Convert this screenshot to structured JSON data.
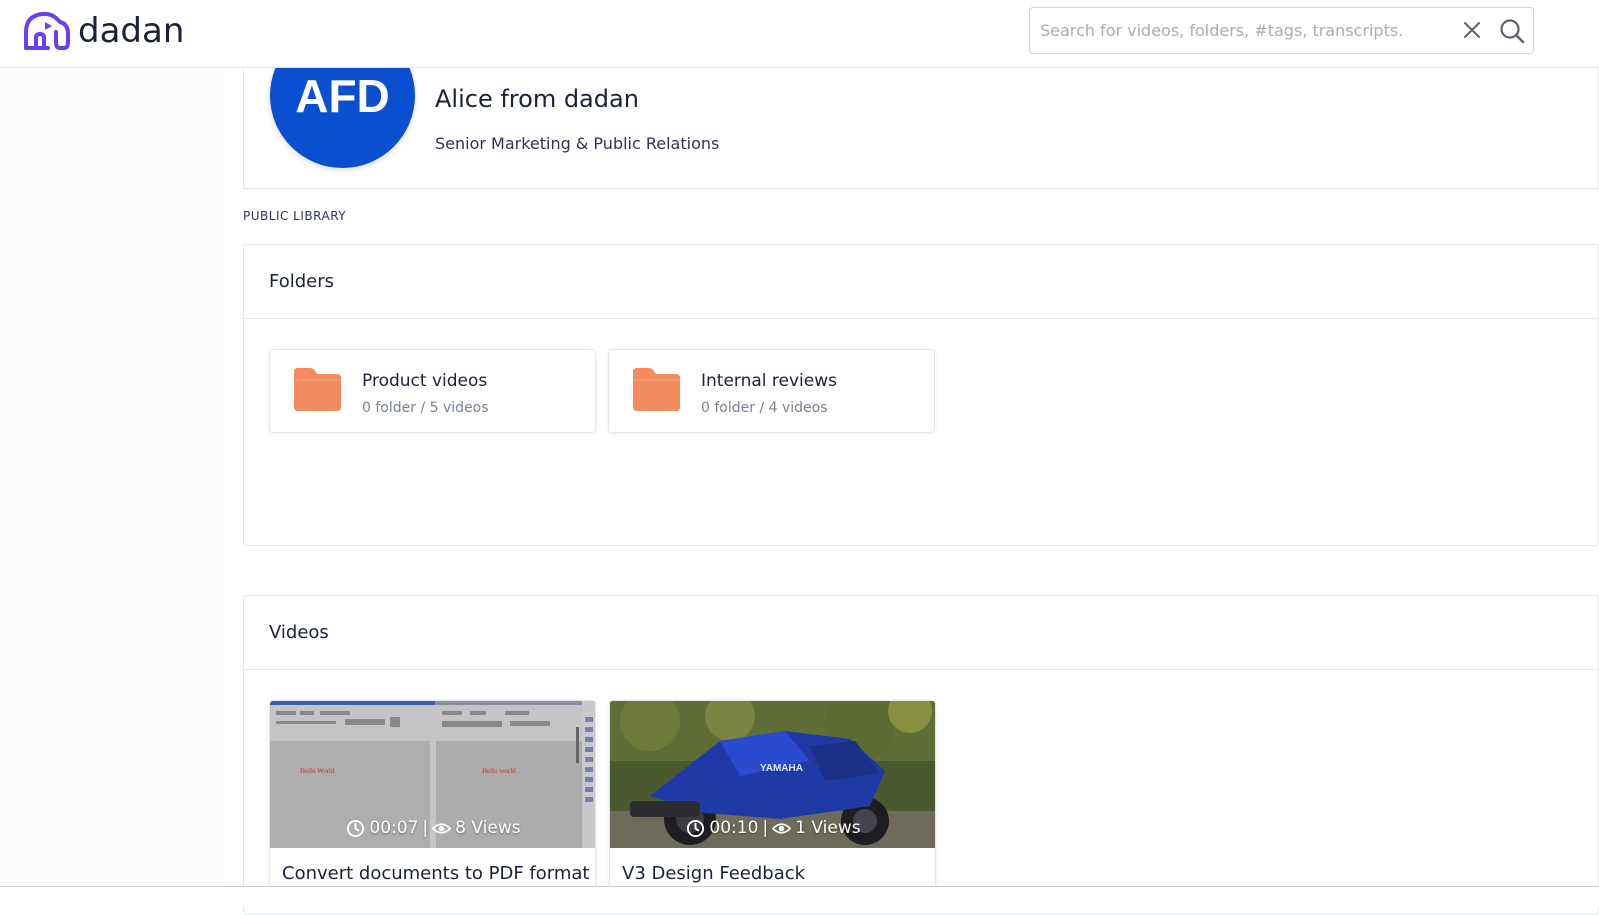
{
  "app": {
    "name": "dadan",
    "brand_color": "#6a3df0"
  },
  "search": {
    "placeholder": "Search for videos, folders, #tags, transcripts.",
    "value": ""
  },
  "profile": {
    "initials": "AFD",
    "name": "Alice from dadan",
    "role": "Senior Marketing & Public Relations",
    "avatar_color": "#0a4fcf"
  },
  "library": {
    "label": "PUBLIC LIBRARY",
    "folders_title": "Folders",
    "folders": [
      {
        "name": "Product videos",
        "meta": "0 folder / 5 videos",
        "icon": "folder-icon",
        "color": "#f28b5e"
      },
      {
        "name": "Internal reviews",
        "meta": "0 folder / 4 videos",
        "icon": "folder-icon",
        "color": "#f28b5e"
      }
    ],
    "videos_title": "Videos",
    "videos": [
      {
        "title": "Convert documents to PDF format",
        "duration": "00:07",
        "separator": "|",
        "views": "8 Views",
        "thumb_text_left": "Hello World",
        "thumb_text_right": "Hello world"
      },
      {
        "title": "V3 Design Feedback",
        "duration": "00:10",
        "separator": "|",
        "views": "1 Views",
        "thumb_brand": "YAMAHA"
      }
    ]
  }
}
